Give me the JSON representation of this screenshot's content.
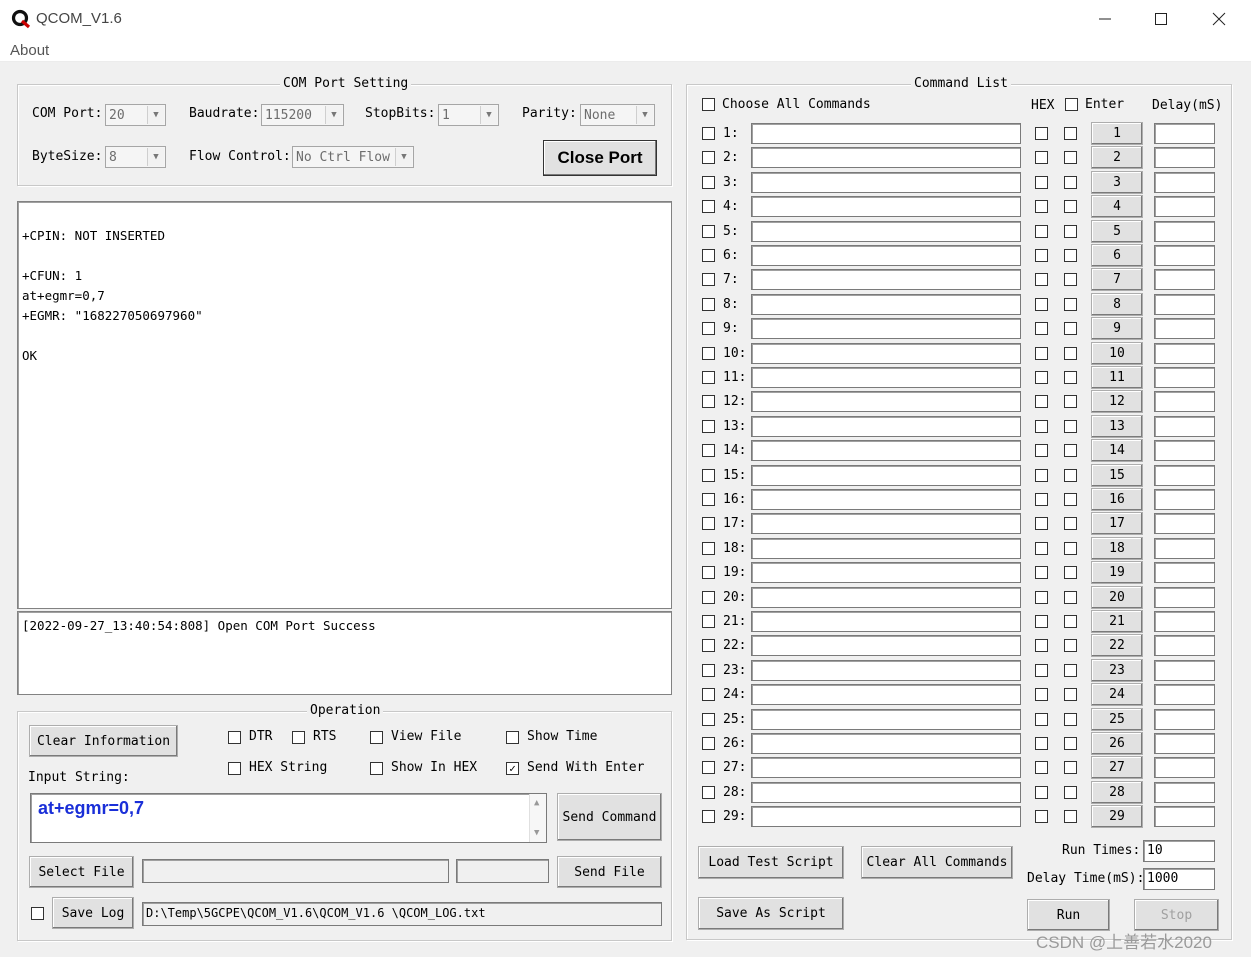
{
  "window": {
    "title": "QCOM_V1.6",
    "icon": "q-logo-icon",
    "controls": [
      "minimize-icon",
      "maximize-icon",
      "close-icon"
    ]
  },
  "menu": {
    "about": "About"
  },
  "com_port_setting": {
    "legend": "COM Port Setting",
    "com_port_label": "COM Port:",
    "com_port_value": "20",
    "baudrate_label": "Baudrate:",
    "baudrate_value": "115200",
    "stopbits_label": "StopBits:",
    "stopbits_value": "1",
    "parity_label": "Parity:",
    "parity_value": "None",
    "bytesize_label": "ByteSize:",
    "bytesize_value": "8",
    "flow_label": "Flow Control:",
    "flow_value": "No Ctrl Flow",
    "close_port_label": "Close Port"
  },
  "receive_lines": [
    "",
    "+CPIN: NOT INSERTED",
    "",
    "+CFUN: 1",
    "at+egmr=0,7",
    "+EGMR: \"168227050697960\"",
    "",
    "OK"
  ],
  "log_lines": [
    "[2022-09-27_13:40:54:808] Open COM Port Success"
  ],
  "operation": {
    "legend": "Operation",
    "clear_info_label": "Clear Information",
    "dtr_label": "DTR",
    "dtr_checked": false,
    "rts_label": "RTS",
    "rts_checked": false,
    "view_file_label": "View File",
    "view_file_checked": false,
    "show_time_label": "Show Time",
    "show_time_checked": false,
    "hex_string_label": "HEX String",
    "hex_string_checked": false,
    "show_in_hex_label": "Show In HEX",
    "show_in_hex_checked": false,
    "send_with_enter_label": "Send With Enter",
    "send_with_enter_checked": true,
    "input_string_label": "Input String:",
    "input_string_value": "at+egmr=0,7",
    "send_command_label": "Send Command",
    "select_file_label": "Select File",
    "send_file_label": "Send File",
    "save_log_label": "Save Log",
    "save_log_checked": false,
    "log_path_value": "D:\\Temp\\5GCPE\\QCOM_V1.6\\QCOM_V1.6 \\QCOM_LOG.txt"
  },
  "command_list": {
    "legend": "Command List",
    "choose_all_label": "Choose All Commands",
    "hex_header": "HEX",
    "enter_header": "Enter",
    "delay_header": "Delay(mS)",
    "rows": [
      {
        "label": "1:",
        "button": "1"
      },
      {
        "label": "2:",
        "button": "2"
      },
      {
        "label": "3:",
        "button": "3"
      },
      {
        "label": "4:",
        "button": "4"
      },
      {
        "label": "5:",
        "button": "5"
      },
      {
        "label": "6:",
        "button": "6"
      },
      {
        "label": "7:",
        "button": "7"
      },
      {
        "label": "8:",
        "button": "8"
      },
      {
        "label": "9:",
        "button": "9"
      },
      {
        "label": "10:",
        "button": "10"
      },
      {
        "label": "11:",
        "button": "11"
      },
      {
        "label": "12:",
        "button": "12"
      },
      {
        "label": "13:",
        "button": "13"
      },
      {
        "label": "14:",
        "button": "14"
      },
      {
        "label": "15:",
        "button": "15"
      },
      {
        "label": "16:",
        "button": "16"
      },
      {
        "label": "17:",
        "button": "17"
      },
      {
        "label": "18:",
        "button": "18"
      },
      {
        "label": "19:",
        "button": "19"
      },
      {
        "label": "20:",
        "button": "20"
      },
      {
        "label": "21:",
        "button": "21"
      },
      {
        "label": "22:",
        "button": "22"
      },
      {
        "label": "23:",
        "button": "23"
      },
      {
        "label": "24:",
        "button": "24"
      },
      {
        "label": "25:",
        "button": "25"
      },
      {
        "label": "26:",
        "button": "26"
      },
      {
        "label": "27:",
        "button": "27"
      },
      {
        "label": "28:",
        "button": "28"
      },
      {
        "label": "29:",
        "button": "29"
      }
    ],
    "load_test_script_label": "Load Test Script",
    "clear_all_commands_label": "Clear All Commands",
    "save_as_script_label": "Save As Script",
    "run_times_label": "Run Times:",
    "run_times_value": "10",
    "delay_time_label": "Delay Time(mS):",
    "delay_time_value": "1000",
    "run_label": "Run",
    "stop_label": "Stop"
  },
  "watermark": "CSDN @上善若水2020"
}
